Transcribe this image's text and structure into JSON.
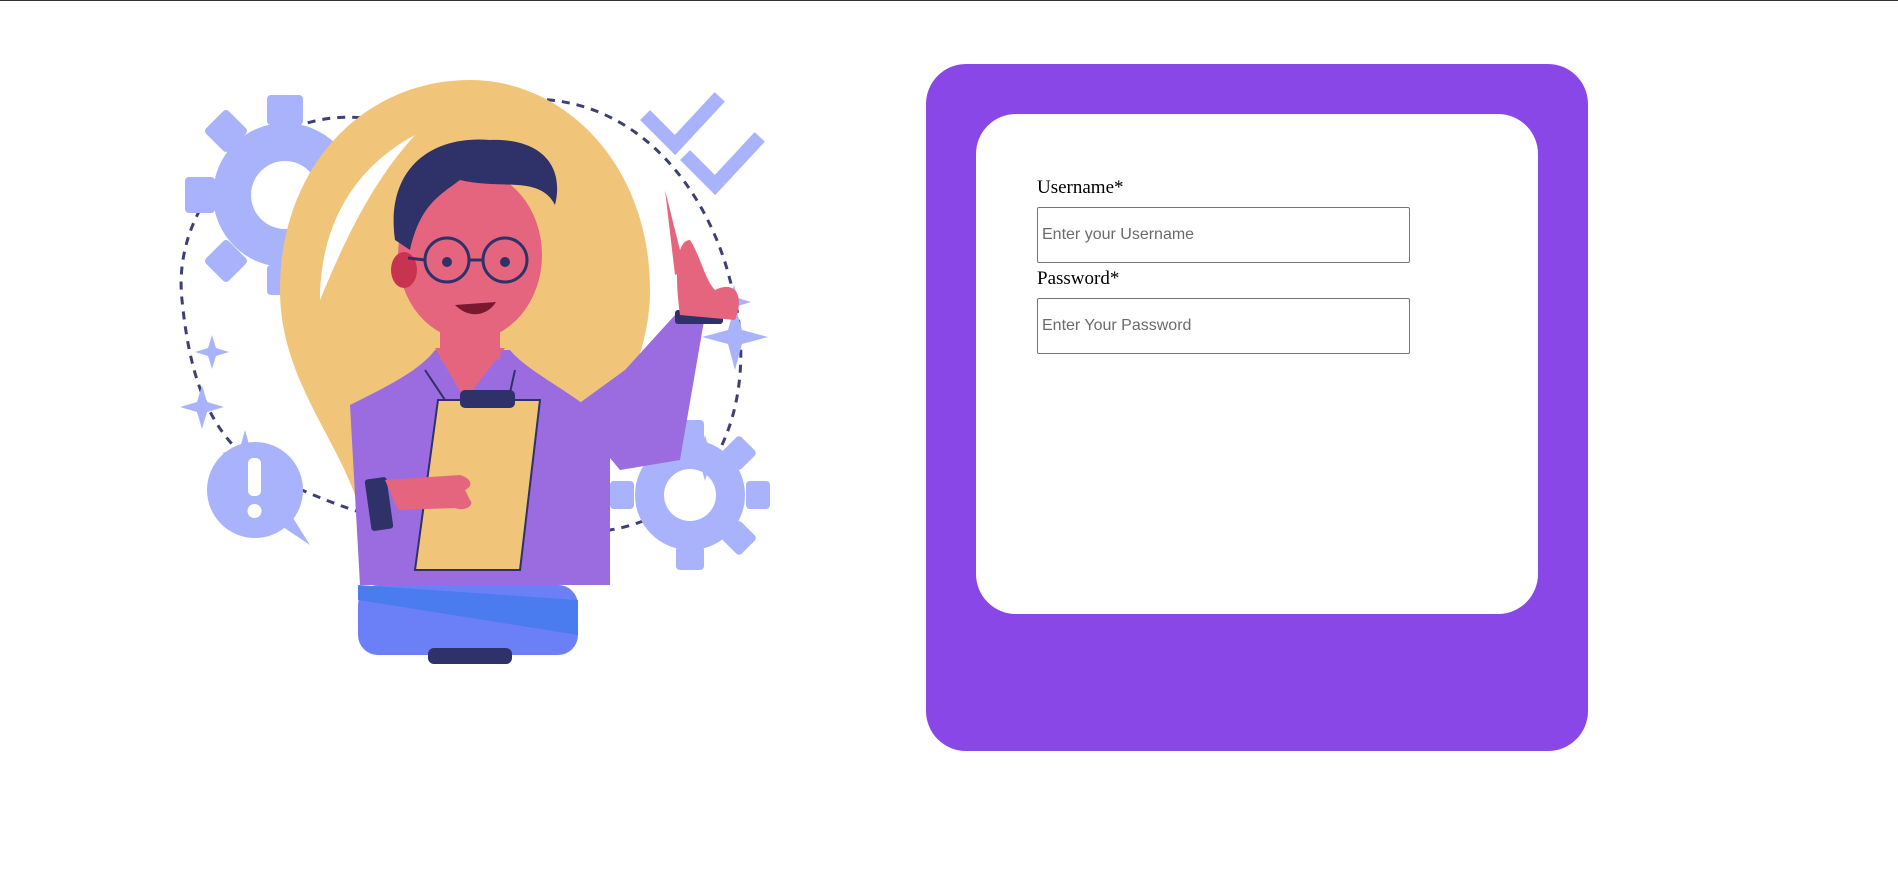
{
  "colors": {
    "panel": "#8a47e8",
    "card": "#ffffff",
    "illustration_bulb": "#f0c57a",
    "illustration_shirt": "#9b6be0",
    "illustration_accent": "#a9b3fb",
    "illustration_hair": "#2f3169",
    "illustration_skin": "#e5657f",
    "illustration_base": "#6b80f7"
  },
  "illustration": {
    "icons": [
      "gear-icon",
      "checkmark-icon",
      "exclamation-icon",
      "sparkle-icon",
      "lightbulb-icon"
    ]
  },
  "login": {
    "username_label": "Username*",
    "username_placeholder": "Enter your Username",
    "username_value": "",
    "password_label": "Password*",
    "password_placeholder": "Enter Your Password",
    "password_value": ""
  }
}
